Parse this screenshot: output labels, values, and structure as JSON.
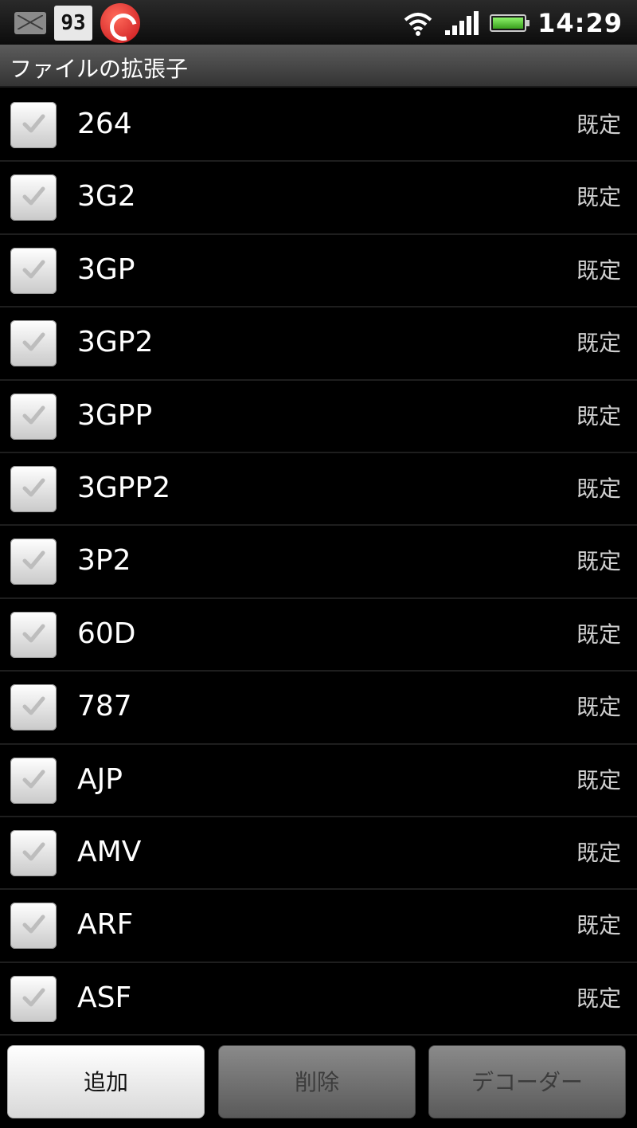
{
  "status_bar": {
    "calendar_day": "93",
    "time": "14:29",
    "icons": [
      "mail-icon",
      "calendar-icon",
      "trend-micro-icon",
      "wifi-icon",
      "signal-icon",
      "battery-icon"
    ]
  },
  "title": "ファイルの拡張子",
  "list": {
    "items": [
      {
        "label": "264",
        "tag": "既定",
        "checked": true
      },
      {
        "label": "3G2",
        "tag": "既定",
        "checked": true
      },
      {
        "label": "3GP",
        "tag": "既定",
        "checked": true
      },
      {
        "label": "3GP2",
        "tag": "既定",
        "checked": true
      },
      {
        "label": "3GPP",
        "tag": "既定",
        "checked": true
      },
      {
        "label": "3GPP2",
        "tag": "既定",
        "checked": true
      },
      {
        "label": "3P2",
        "tag": "既定",
        "checked": true
      },
      {
        "label": "60D",
        "tag": "既定",
        "checked": true
      },
      {
        "label": "787",
        "tag": "既定",
        "checked": true
      },
      {
        "label": "AJP",
        "tag": "既定",
        "checked": true
      },
      {
        "label": "AMV",
        "tag": "既定",
        "checked": true
      },
      {
        "label": "ARF",
        "tag": "既定",
        "checked": true
      },
      {
        "label": "ASF",
        "tag": "既定",
        "checked": true
      }
    ]
  },
  "buttons": {
    "add": "追加",
    "delete": "削除",
    "decoder": "デコーダー"
  },
  "colors": {
    "background": "#000000",
    "title_bar": "#4a4a4a",
    "battery": "#5fd23a",
    "disabled_button": "#6e6e6e"
  }
}
